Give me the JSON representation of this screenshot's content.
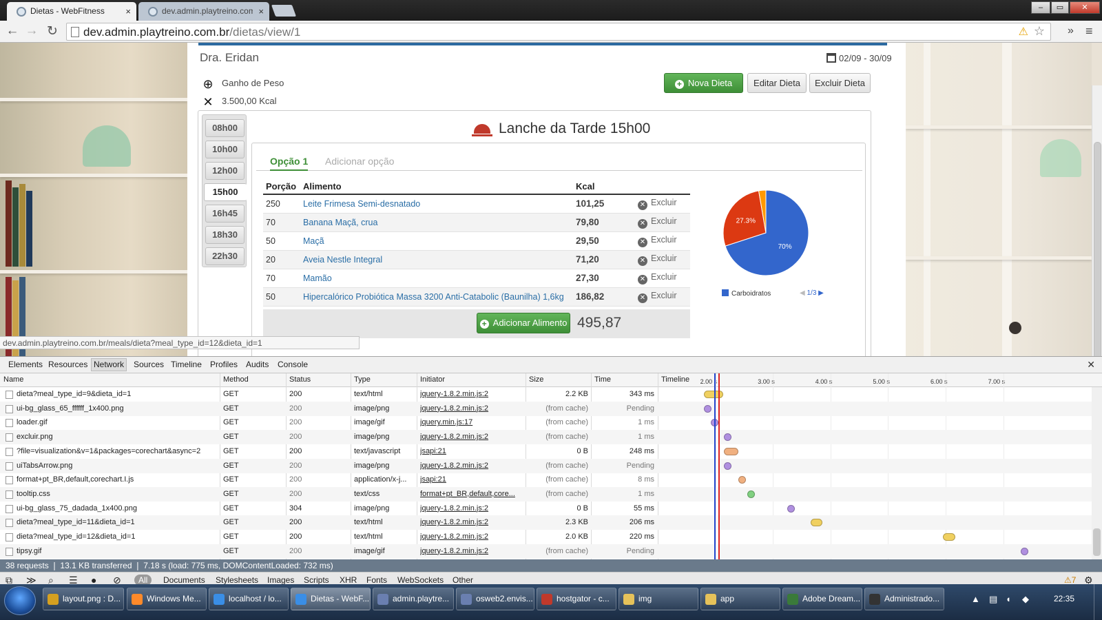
{
  "browser": {
    "tabs": [
      {
        "title": "Dietas - WebFitness",
        "close": "×",
        "active": true
      },
      {
        "title": "dev.admin.playtreino.com",
        "close": "×",
        "active": false
      }
    ],
    "window_buttons": {
      "min": "‒",
      "max": "▭",
      "close": "✕"
    },
    "url_host": "dev.admin.playtreino.com.br",
    "url_path": "/dietas/view/1",
    "status_url": "dev.admin.playtreino.com.br/meals/dieta?meal_type_id=12&dieta_id=1"
  },
  "page": {
    "doctor": "Dra. Eridan",
    "date_range": "02/09 - 30/09",
    "goal": "Ganho de Peso",
    "kcal": "3.500,00 Kcal",
    "buttons": {
      "new": "Nova Dieta",
      "edit": "Editar Dieta",
      "delete": "Excluir Dieta"
    },
    "time_tabs": [
      "08h00",
      "10h00",
      "12h00",
      "15h00",
      "16h45",
      "18h30",
      "22h30"
    ],
    "active_time": "15h00",
    "meal_title": "Lanche da Tarde 15h00",
    "option_tabs": {
      "active": "Opção 1",
      "add": "Adicionar opção"
    },
    "table": {
      "headers": [
        "Porção",
        "Alimento",
        "Kcal"
      ],
      "delete_label": "Excluir",
      "rows": [
        {
          "portion": "250",
          "food": "Leite Frimesa Semi-desnatado",
          "kcal": "101,25"
        },
        {
          "portion": "70",
          "food": "Banana Maçã, crua",
          "kcal": "79,80"
        },
        {
          "portion": "50",
          "food": "Maçã",
          "kcal": "29,50"
        },
        {
          "portion": "20",
          "food": "Aveia Nestle Integral",
          "kcal": "71,20"
        },
        {
          "portion": "70",
          "food": "Mamão",
          "kcal": "27,30"
        },
        {
          "portion": "50",
          "food": "Hipercalórico Probiótica Massa 3200 Anti-Catabolic (Baunilha) 1,6kg",
          "kcal": "186,82"
        }
      ],
      "add_button": "Adicionar Alimento",
      "total": "495,87"
    }
  },
  "chart_data": {
    "type": "pie",
    "slices": [
      {
        "label": "70%",
        "value": 70,
        "color": "#3366cc"
      },
      {
        "label": "27.3%",
        "value": 27.3,
        "color": "#dc3912"
      },
      {
        "label": "",
        "value": 2.7,
        "color": "#ff9900"
      }
    ],
    "legend": [
      "Carboidratos"
    ],
    "legend_position": "bottom",
    "pager": "1/3"
  },
  "devtools": {
    "panels": [
      "Elements",
      "Resources",
      "Network",
      "Sources",
      "Timeline",
      "Profiles",
      "Audits",
      "Console"
    ],
    "active_panel": "Network",
    "columns": [
      "Name",
      "Method",
      "Status",
      "Type",
      "Initiator",
      "Size",
      "Time",
      "Timeline"
    ],
    "timeline_ticks": [
      "2.00 s",
      "3.00 s",
      "4.00 s",
      "5.00 s",
      "6.00 s",
      "7.00 s"
    ],
    "requests": [
      {
        "name": "dieta?meal_type_id=9&dieta_id=1",
        "method": "GET",
        "status": "200",
        "type": "text/html",
        "initiator": "jquery-1.8.2.min.js:2",
        "size": "2.2 KB",
        "time": "343 ms",
        "start_s": 1.8,
        "dur_s": 0.34,
        "kind": "doc",
        "cached": false
      },
      {
        "name": "ui-bg_glass_65_ffffff_1x400.png",
        "method": "GET",
        "status": "200",
        "type": "image/png",
        "initiator": "jquery-1.8.2.min.js:2",
        "size": "(from cache)",
        "time": "Pending",
        "start_s": 1.8,
        "dur_s": 0,
        "kind": "img",
        "cached": true
      },
      {
        "name": "loader.gif",
        "method": "GET",
        "status": "200",
        "type": "image/gif",
        "initiator": "jquery.min.js:17",
        "size": "(from cache)",
        "time": "1 ms",
        "start_s": 1.92,
        "dur_s": 0,
        "kind": "img",
        "cached": true
      },
      {
        "name": "excluir.png",
        "method": "GET",
        "status": "200",
        "type": "image/png",
        "initiator": "jquery-1.8.2.min.js:2",
        "size": "(from cache)",
        "time": "1 ms",
        "start_s": 2.15,
        "dur_s": 0,
        "kind": "img",
        "cached": true
      },
      {
        "name": "?file=visualization&v=1&packages=corechart&async=2",
        "method": "GET",
        "status": "200",
        "type": "text/javascript",
        "initiator": "jsapi:21",
        "size": "0 B",
        "time": "248 ms",
        "start_s": 2.15,
        "dur_s": 0.25,
        "kind": "script",
        "cached": false
      },
      {
        "name": "uiTabsArrow.png",
        "method": "GET",
        "status": "200",
        "type": "image/png",
        "initiator": "jquery-1.8.2.min.js:2",
        "size": "(from cache)",
        "time": "Pending",
        "start_s": 2.15,
        "dur_s": 0,
        "kind": "img",
        "cached": true
      },
      {
        "name": "format+pt_BR,default,corechart.I.js",
        "method": "GET",
        "status": "200",
        "type": "application/x-j...",
        "initiator": "jsapi:21",
        "size": "(from cache)",
        "time": "8 ms",
        "start_s": 2.4,
        "dur_s": 0,
        "kind": "script",
        "cached": true
      },
      {
        "name": "tooltip.css",
        "method": "GET",
        "status": "200",
        "type": "text/css",
        "initiator": "format+pt_BR,default,core...",
        "size": "(from cache)",
        "time": "1 ms",
        "start_s": 2.55,
        "dur_s": 0,
        "kind": "css",
        "cached": true
      },
      {
        "name": "ui-bg_glass_75_dadada_1x400.png",
        "method": "GET",
        "status": "304",
        "type": "image/png",
        "initiator": "jquery-1.8.2.min.js:2",
        "size": "0 B",
        "time": "55 ms",
        "start_s": 3.25,
        "dur_s": 0.06,
        "kind": "img",
        "cached": false
      },
      {
        "name": "dieta?meal_type_id=11&dieta_id=1",
        "method": "GET",
        "status": "200",
        "type": "text/html",
        "initiator": "jquery-1.8.2.min.js:2",
        "size": "2.3 KB",
        "time": "206 ms",
        "start_s": 3.65,
        "dur_s": 0.21,
        "kind": "doc",
        "cached": false
      },
      {
        "name": "dieta?meal_type_id=12&dieta_id=1",
        "method": "GET",
        "status": "200",
        "type": "text/html",
        "initiator": "jquery-1.8.2.min.js:2",
        "size": "2.0 KB",
        "time": "220 ms",
        "start_s": 5.95,
        "dur_s": 0.22,
        "kind": "doc",
        "cached": false
      },
      {
        "name": "tipsy.gif",
        "method": "GET",
        "status": "200",
        "type": "image/gif",
        "initiator": "jquery-1.8.2.min.js:2",
        "size": "(from cache)",
        "time": "Pending",
        "start_s": 7.3,
        "dur_s": 0,
        "kind": "img",
        "cached": true
      }
    ],
    "summary": "38 requests ❘ 13.1 KB transferred ❘ 7.18 s (load: 775 ms, DOMContentLoaded: 732 ms)",
    "filters": [
      "All",
      "Documents",
      "Stylesheets",
      "Images",
      "Scripts",
      "XHR",
      "Fonts",
      "WebSockets",
      "Other"
    ],
    "warnings": "7"
  },
  "taskbar": {
    "items": [
      "layout.png : D...",
      "Windows Me...",
      "localhost / lo...",
      "Dietas - WebF...",
      "admin.playtre...",
      "osweb2.envis...",
      "hostgator - c...",
      "img",
      "app",
      "Adobe Dream...",
      "Administrado..."
    ],
    "active_index": 3,
    "clock": "22:35"
  }
}
